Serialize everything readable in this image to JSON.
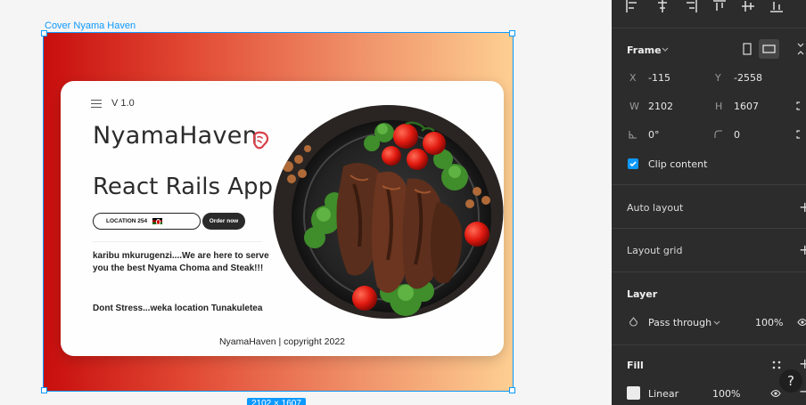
{
  "canvas": {
    "frame_label": "Cover Nyama Haven",
    "size_badge": "2102 × 1607",
    "card": {
      "version": "V 1.0",
      "brand": "NyamaHaven",
      "app_title": "React Rails App",
      "location_label": "LOCATION  254",
      "order_label": "Order now",
      "welcome_1": "karibu mkurugenzi....We are here to serve you the best Nyama Choma and Steak!!!",
      "welcome_2": "Dont Stress...weka location Tunakuletea",
      "copyright": "NyamaHaven | copyright 2022"
    },
    "gradient": [
      "#c80e0e",
      "#fdcf92"
    ]
  },
  "panel": {
    "frame_title": "Frame",
    "x_label": "X",
    "x_value": "-115",
    "y_label": "Y",
    "y_value": "-2558",
    "w_label": "W",
    "w_value": "2102",
    "h_label": "H",
    "h_value": "1607",
    "rotation_value": "0°",
    "radius_value": "0",
    "clip_content": "Clip content",
    "auto_layout": "Auto layout",
    "layout_grid": "Layout grid",
    "layer_title": "Layer",
    "blend_mode": "Pass through",
    "layer_opacity": "100%",
    "fill_title": "Fill",
    "fill_type": "Linear",
    "fill_opacity": "100%",
    "help": "?",
    "accent": "#0d99ff"
  }
}
